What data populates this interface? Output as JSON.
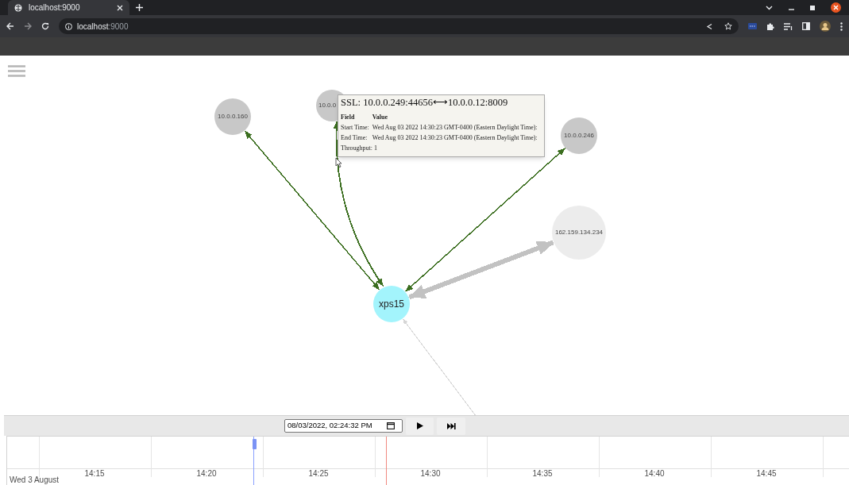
{
  "browser": {
    "tab_title": "localhost:9000",
    "url_host": "localhost",
    "url_port": ":9000"
  },
  "graph": {
    "nodes": [
      {
        "label": "10.0.0.160",
        "kind": "host"
      },
      {
        "label": "10.0.0",
        "kind": "host"
      },
      {
        "label": "10.0.0.246",
        "kind": "host"
      },
      {
        "label": "162.159.134.234",
        "kind": "external"
      },
      {
        "label": "xps15",
        "kind": "self"
      }
    ],
    "edges": [
      {
        "color": "#3b6e1f",
        "kind": "thin"
      },
      {
        "color": "#3b6e1f",
        "kind": "medium"
      },
      {
        "color": "#3b6e1f",
        "kind": "thin"
      },
      {
        "color": "#c2c2c2",
        "kind": "thick"
      },
      {
        "color": "#d6d6d6",
        "kind": "faint"
      }
    ]
  },
  "tooltip": {
    "title": "SSL: 10.0.0.249:44656⟷10.0.0.12:8009",
    "headers": [
      "Field",
      "Value"
    ],
    "rows": [
      [
        "Start Time:",
        "Wed Aug 03 2022 14:30:23 GMT-0400 (Eastern Daylight Time):"
      ],
      [
        "End Time:",
        "Wed Aug 03 2022 14:30:23 GMT-0400 (Eastern Daylight Time):"
      ]
    ],
    "footer": "Throughput: 1"
  },
  "controls": {
    "date_field": {
      "value": "08/03/2022, 02:24:32 PM"
    }
  },
  "timeline": {
    "ticks": [
      "14:15",
      "14:20",
      "14:25",
      "14:30",
      "14:35",
      "14:40",
      "14:45"
    ],
    "date_label": "Wed 3 August"
  }
}
